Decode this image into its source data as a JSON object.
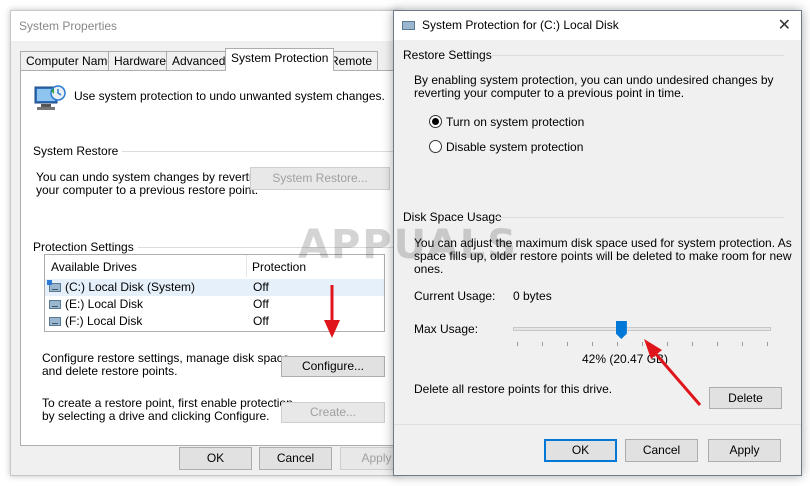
{
  "system_properties": {
    "title": "System Properties",
    "tabs": [
      "Computer Name",
      "Hardware",
      "Advanced",
      "System Protection",
      "Remote"
    ],
    "active_tab": "System Protection",
    "intro_text": "Use system protection to undo unwanted system changes.",
    "system_restore": {
      "heading": "System Restore",
      "description": "You can undo system changes by reverting\nyour computer to a previous restore point.",
      "button": "System Restore..."
    },
    "protection_settings": {
      "heading": "Protection Settings",
      "columns": [
        "Available Drives",
        "Protection"
      ],
      "drives": [
        {
          "name": "(C:) Local Disk (System)",
          "protection": "Off",
          "system": true
        },
        {
          "name": "(E:) Local Disk",
          "protection": "Off",
          "system": false
        },
        {
          "name": "(F:) Local Disk",
          "protection": "Off",
          "system": false
        }
      ],
      "configure_text": "Configure restore settings, manage disk space,\nand delete restore points.",
      "configure_button": "Configure...",
      "create_text": "To create a restore point, first enable protection\nby selecting a drive and clicking Configure.",
      "create_button": "Create..."
    },
    "buttons": {
      "ok": "OK",
      "cancel": "Cancel",
      "apply": "Apply"
    }
  },
  "protection_dialog": {
    "title": "System Protection for (C:) Local Disk",
    "close_icon": "close-icon",
    "restore_settings": {
      "heading": "Restore Settings",
      "description": "By enabling system protection, you can undo undesired changes by\nreverting your computer to a previous point in time.",
      "options": [
        {
          "label": "Turn on system protection",
          "checked": true
        },
        {
          "label": "Disable system protection",
          "checked": false
        }
      ]
    },
    "disk_space": {
      "heading": "Disk Space Usage",
      "description": "You can adjust the maximum disk space used for system protection. As\nspace fills up, older restore points will be deleted to make room for new\nones.",
      "current_usage_label": "Current Usage:",
      "current_usage_value": "0 bytes",
      "max_usage_label": "Max Usage:",
      "max_usage_fraction": 0.42,
      "max_usage_readout": "42% (20.47 GB)",
      "delete_text": "Delete all restore points for this drive.",
      "delete_button": "Delete"
    },
    "buttons": {
      "ok": "OK",
      "cancel": "Cancel",
      "apply": "Apply"
    }
  },
  "watermark": "APPUALS",
  "colors": {
    "accent": "#0078d7",
    "arrow": "#e0141b"
  }
}
